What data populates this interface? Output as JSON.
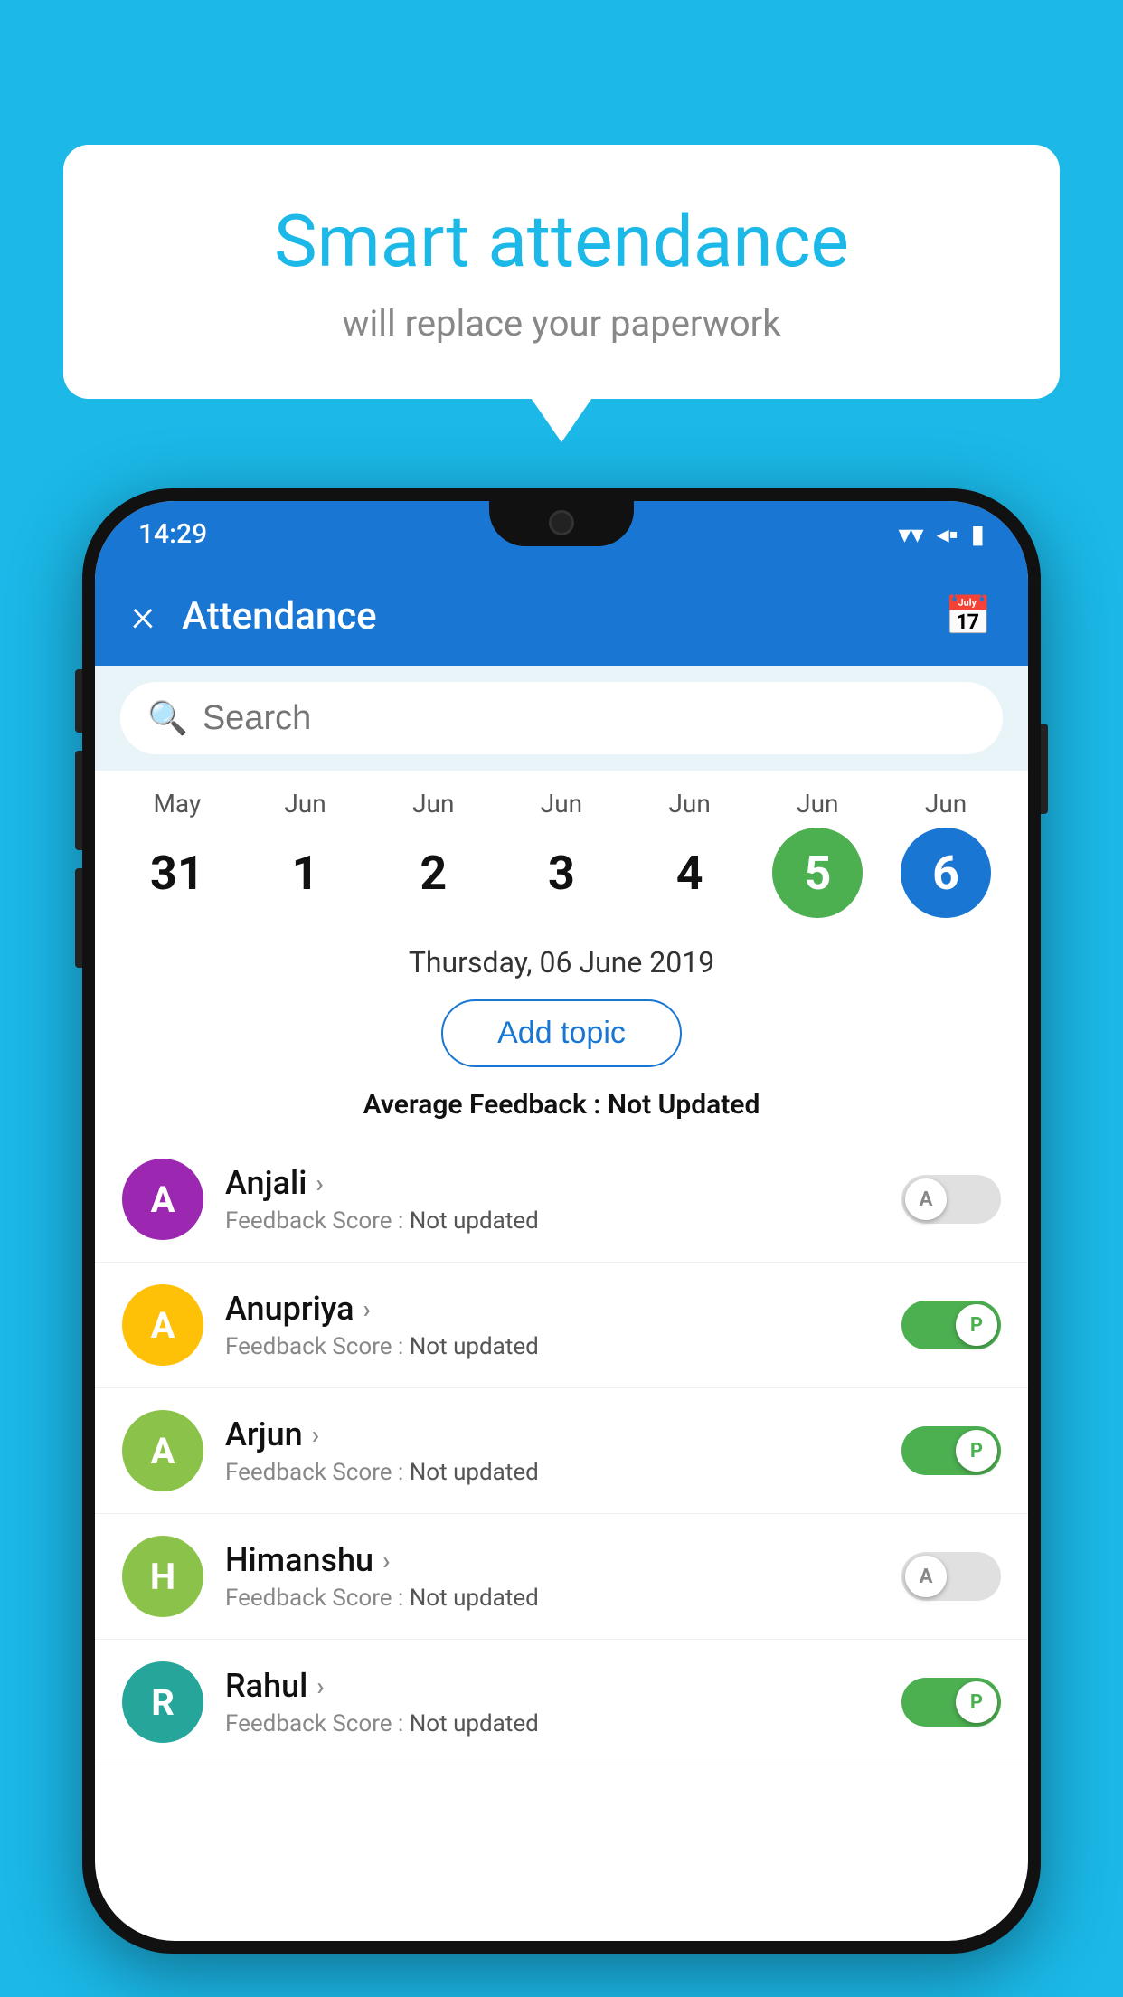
{
  "background_color": "#1bb8e8",
  "speech_bubble": {
    "title": "Smart attendance",
    "subtitle": "will replace your paperwork"
  },
  "status_bar": {
    "time": "14:29",
    "wifi": "▼",
    "signal": "◀",
    "battery": "▮"
  },
  "app_bar": {
    "title": "Attendance",
    "close_label": "×",
    "calendar_label": "📅"
  },
  "search": {
    "placeholder": "Search"
  },
  "calendar": {
    "days": [
      {
        "month": "May",
        "day": "31",
        "state": "normal"
      },
      {
        "month": "Jun",
        "day": "1",
        "state": "normal"
      },
      {
        "month": "Jun",
        "day": "2",
        "state": "normal"
      },
      {
        "month": "Jun",
        "day": "3",
        "state": "normal"
      },
      {
        "month": "Jun",
        "day": "4",
        "state": "normal"
      },
      {
        "month": "Jun",
        "day": "5",
        "state": "today"
      },
      {
        "month": "Jun",
        "day": "6",
        "state": "selected"
      }
    ]
  },
  "selected_date": "Thursday, 06 June 2019",
  "add_topic_label": "Add topic",
  "avg_feedback_label": "Average Feedback : ",
  "avg_feedback_value": "Not Updated",
  "students": [
    {
      "name": "Anjali",
      "initial": "A",
      "avatar_color": "#9c27b0",
      "feedback_label": "Feedback Score : ",
      "feedback_value": "Not updated",
      "toggle_state": "off",
      "toggle_letter": "A"
    },
    {
      "name": "Anupriya",
      "initial": "A",
      "avatar_color": "#ffc107",
      "feedback_label": "Feedback Score : ",
      "feedback_value": "Not updated",
      "toggle_state": "on",
      "toggle_letter": "P"
    },
    {
      "name": "Arjun",
      "initial": "A",
      "avatar_color": "#8bc34a",
      "feedback_label": "Feedback Score : ",
      "feedback_value": "Not updated",
      "toggle_state": "on",
      "toggle_letter": "P"
    },
    {
      "name": "Himanshu",
      "initial": "H",
      "avatar_color": "#8bc34a",
      "feedback_label": "Feedback Score : ",
      "feedback_value": "Not updated",
      "toggle_state": "off",
      "toggle_letter": "A"
    },
    {
      "name": "Rahul",
      "initial": "R",
      "avatar_color": "#26a69a",
      "feedback_label": "Feedback Score : ",
      "feedback_value": "Not updated",
      "toggle_state": "on",
      "toggle_letter": "P"
    }
  ]
}
